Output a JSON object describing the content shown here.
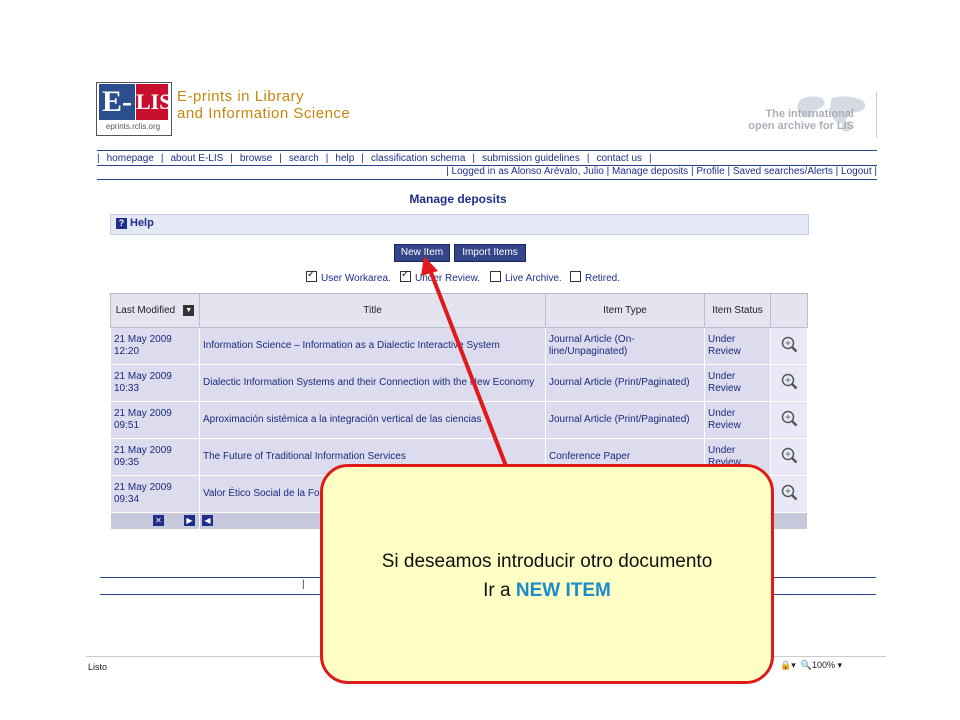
{
  "header": {
    "logo_e": "E-",
    "logo_lis": "LIS",
    "logo_url": "eprints.rclis.org",
    "site_title_line1": "E-prints in Library",
    "site_title_line2": "and Information Science",
    "tagline_line1": "The international",
    "tagline_line2": "open archive for LIS"
  },
  "menu": {
    "items": [
      "homepage",
      "about E-LIS",
      "browse",
      "search",
      "help",
      "classification schema",
      "submission guidelines",
      "contact us"
    ]
  },
  "userbar": {
    "text": "| Logged in as Alonso Arévalo, Julio | Manage deposits | Profile | Saved searches/Alerts | Logout |"
  },
  "page": {
    "title": "Manage deposits",
    "help_label": "Help"
  },
  "buttons": {
    "new_item": "New Item",
    "import_items": "Import Items"
  },
  "filters": [
    {
      "label": "User Workarea.",
      "checked": true
    },
    {
      "label": "Under Review.",
      "checked": true
    },
    {
      "label": "Live Archive.",
      "checked": false
    },
    {
      "label": "Retired.",
      "checked": false
    }
  ],
  "table": {
    "headers": {
      "last_modified": "Last Modified",
      "title": "Title",
      "item_type": "Item Type",
      "item_status": "Item Status"
    },
    "rows": [
      {
        "date": "21 May 2009",
        "time": "12:20",
        "title": "Information Science – Information as a Dialectic Interactive System",
        "type": "Journal Article (On-line/Unpaginated)",
        "status": "Under Review"
      },
      {
        "date": "21 May 2009",
        "time": "10:33",
        "title": "Dialectic Information Systems and their Connection with the New Economy",
        "type": "Journal Article (Print/Paginated)",
        "status": "Under Review"
      },
      {
        "date": "21 May 2009",
        "time": "09:51",
        "title": "Aproximación sistémica a la integración vertical de las ciencias",
        "type": "Journal Article (Print/Paginated)",
        "status": "Under Review"
      },
      {
        "date": "21 May 2009",
        "time": "09:35",
        "title": "The Future of Traditional Information Services",
        "type": "Conference Paper",
        "status": "Under Review"
      },
      {
        "date": "21 May 2009",
        "time": "09:34",
        "title": "Valor Ético Social de la Fo... Sociedad Actual",
        "type": "",
        "status": ""
      }
    ]
  },
  "footer": {
    "separator": "|"
  },
  "statusbar": {
    "left": "Listo",
    "zoom": "100%"
  },
  "callout": {
    "line1": "Si deseamos introducir otro documento",
    "line2_prefix": "Ir a ",
    "line2_highlight": "NEW ITEM"
  },
  "colors": {
    "callout_border": "#e01a1a",
    "callout_fill": "#fdfdc4",
    "highlight": "#1a8ccc",
    "nav_text": "#1e2e8a"
  }
}
